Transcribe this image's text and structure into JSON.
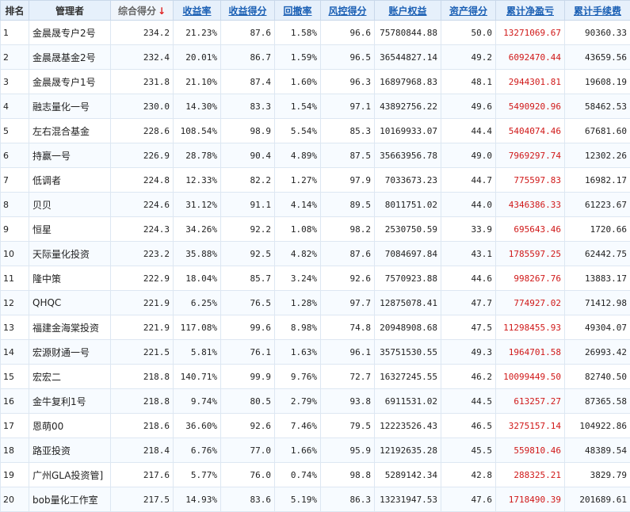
{
  "headers": {
    "rank": "排名",
    "manager": "管理者",
    "total_score": "综合得分",
    "sort_arrow": "↓",
    "return_rate": "收益率",
    "return_score": "收益得分",
    "drawdown": "回撤率",
    "risk_score": "风控得分",
    "equity": "账户权益",
    "asset_score": "资产得分",
    "net_pnl": "累计净盈亏",
    "fees": "累计手续费"
  },
  "rows": [
    {
      "rank": "1",
      "name": "金晨晟专户2号",
      "score": "234.2",
      "ret": "21.23%",
      "ret_score": "87.6",
      "dd": "1.58%",
      "risk": "96.6",
      "equity": "75780844.88",
      "asset": "50.0",
      "pnl": "13271069.67",
      "fee": "90360.33"
    },
    {
      "rank": "2",
      "name": "金晨晟基金2号",
      "score": "232.4",
      "ret": "20.01%",
      "ret_score": "86.7",
      "dd": "1.59%",
      "risk": "96.5",
      "equity": "36544827.14",
      "asset": "49.2",
      "pnl": "6092470.44",
      "fee": "43659.56"
    },
    {
      "rank": "3",
      "name": "金晨晟专户1号",
      "score": "231.8",
      "ret": "21.10%",
      "ret_score": "87.4",
      "dd": "1.60%",
      "risk": "96.3",
      "equity": "16897968.83",
      "asset": "48.1",
      "pnl": "2944301.81",
      "fee": "19608.19"
    },
    {
      "rank": "4",
      "name": "融志量化一号",
      "score": "230.0",
      "ret": "14.30%",
      "ret_score": "83.3",
      "dd": "1.54%",
      "risk": "97.1",
      "equity": "43892756.22",
      "asset": "49.6",
      "pnl": "5490920.96",
      "fee": "58462.53"
    },
    {
      "rank": "5",
      "name": "左右混合基金",
      "score": "228.6",
      "ret": "108.54%",
      "ret_score": "98.9",
      "dd": "5.54%",
      "risk": "85.3",
      "equity": "10169933.07",
      "asset": "44.4",
      "pnl": "5404074.46",
      "fee": "67681.60"
    },
    {
      "rank": "6",
      "name": "持赢一号",
      "score": "226.9",
      "ret": "28.78%",
      "ret_score": "90.4",
      "dd": "4.89%",
      "risk": "87.5",
      "equity": "35663956.78",
      "asset": "49.0",
      "pnl": "7969297.74",
      "fee": "12302.26"
    },
    {
      "rank": "7",
      "name": "低调者",
      "score": "224.8",
      "ret": "12.33%",
      "ret_score": "82.2",
      "dd": "1.27%",
      "risk": "97.9",
      "equity": "7033673.23",
      "asset": "44.7",
      "pnl": "775597.83",
      "fee": "16982.17"
    },
    {
      "rank": "8",
      "name": "贝贝",
      "score": "224.6",
      "ret": "31.12%",
      "ret_score": "91.1",
      "dd": "4.14%",
      "risk": "89.5",
      "equity": "8011751.02",
      "asset": "44.0",
      "pnl": "4346386.33",
      "fee": "61223.67"
    },
    {
      "rank": "9",
      "name": "恒星",
      "score": "224.3",
      "ret": "34.26%",
      "ret_score": "92.2",
      "dd": "1.08%",
      "risk": "98.2",
      "equity": "2530750.59",
      "asset": "33.9",
      "pnl": "695643.46",
      "fee": "1720.66"
    },
    {
      "rank": "10",
      "name": "天际量化投资",
      "score": "223.2",
      "ret": "35.88%",
      "ret_score": "92.5",
      "dd": "4.82%",
      "risk": "87.6",
      "equity": "7084697.84",
      "asset": "43.1",
      "pnl": "1785597.25",
      "fee": "62442.75"
    },
    {
      "rank": "11",
      "name": "隆中策",
      "score": "222.9",
      "ret": "18.04%",
      "ret_score": "85.7",
      "dd": "3.24%",
      "risk": "92.6",
      "equity": "7570923.88",
      "asset": "44.6",
      "pnl": "998267.76",
      "fee": "13883.17"
    },
    {
      "rank": "12",
      "name": "QHQC",
      "score": "221.9",
      "ret": "6.25%",
      "ret_score": "76.5",
      "dd": "1.28%",
      "risk": "97.7",
      "equity": "12875078.41",
      "asset": "47.7",
      "pnl": "774927.02",
      "fee": "71412.98"
    },
    {
      "rank": "13",
      "name": "福建金海棠投资",
      "score": "221.9",
      "ret": "117.08%",
      "ret_score": "99.6",
      "dd": "8.98%",
      "risk": "74.8",
      "equity": "20948908.68",
      "asset": "47.5",
      "pnl": "11298455.93",
      "fee": "49304.07"
    },
    {
      "rank": "14",
      "name": "宏源财通一号",
      "score": "221.5",
      "ret": "5.81%",
      "ret_score": "76.1",
      "dd": "1.63%",
      "risk": "96.1",
      "equity": "35751530.55",
      "asset": "49.3",
      "pnl": "1964701.58",
      "fee": "26993.42"
    },
    {
      "rank": "15",
      "name": "宏宏二",
      "score": "218.8",
      "ret": "140.71%",
      "ret_score": "99.9",
      "dd": "9.76%",
      "risk": "72.7",
      "equity": "16327245.55",
      "asset": "46.2",
      "pnl": "10099449.50",
      "fee": "82740.50"
    },
    {
      "rank": "16",
      "name": "金牛复利1号",
      "score": "218.8",
      "ret": "9.74%",
      "ret_score": "80.5",
      "dd": "2.79%",
      "risk": "93.8",
      "equity": "6911531.02",
      "asset": "44.5",
      "pnl": "613257.27",
      "fee": "87365.58"
    },
    {
      "rank": "17",
      "name": "恩萌00",
      "score": "218.6",
      "ret": "36.60%",
      "ret_score": "92.6",
      "dd": "7.46%",
      "risk": "79.5",
      "equity": "12223526.43",
      "asset": "46.5",
      "pnl": "3275157.14",
      "fee": "104922.86"
    },
    {
      "rank": "18",
      "name": "路亚投资",
      "score": "218.4",
      "ret": "6.76%",
      "ret_score": "77.0",
      "dd": "1.66%",
      "risk": "95.9",
      "equity": "12192635.28",
      "asset": "45.5",
      "pnl": "559810.46",
      "fee": "48389.54"
    },
    {
      "rank": "19",
      "name": "广州GLA投资管]",
      "score": "217.6",
      "ret": "5.77%",
      "ret_score": "76.0",
      "dd": "0.74%",
      "risk": "98.8",
      "equity": "5289142.34",
      "asset": "42.8",
      "pnl": "288325.21",
      "fee": "3829.79"
    },
    {
      "rank": "20",
      "name": "bob量化工作室",
      "score": "217.5",
      "ret": "14.93%",
      "ret_score": "83.6",
      "dd": "5.19%",
      "risk": "86.3",
      "equity": "13231947.53",
      "asset": "47.6",
      "pnl": "1718490.39",
      "fee": "201689.61"
    }
  ],
  "colors": {
    "header_link": "#1a5fb4",
    "pnl_red": "#d01818",
    "header_bg": "#e6f0fb"
  }
}
